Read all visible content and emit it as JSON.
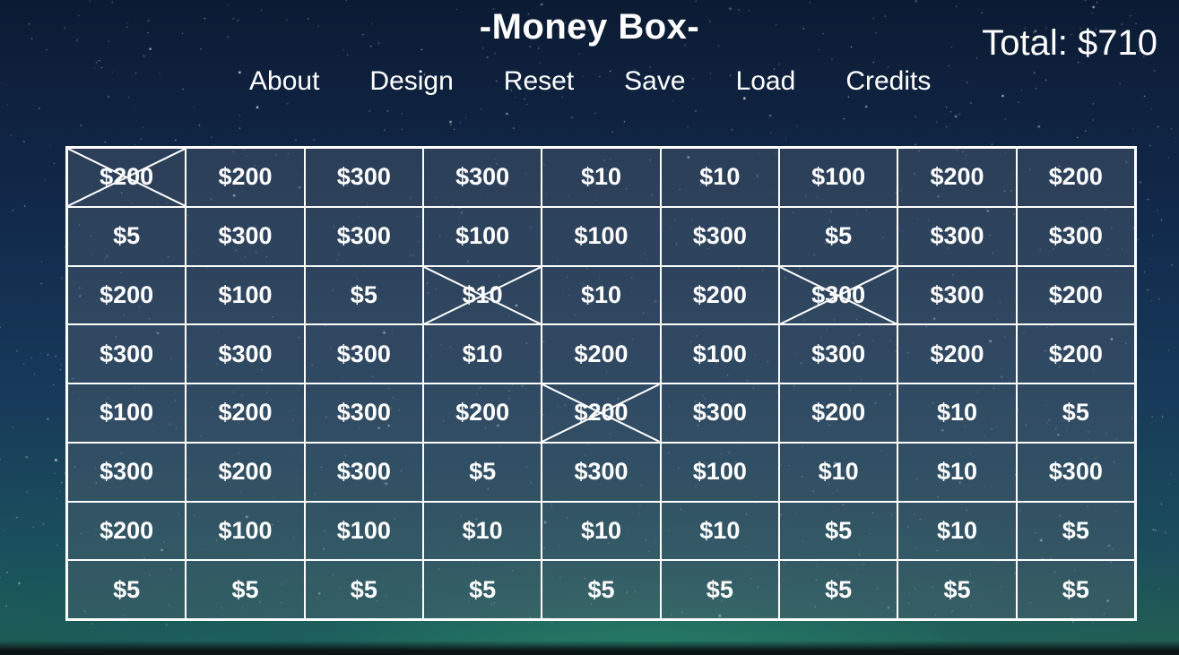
{
  "title": "-Money Box-",
  "total_label": "Total: $710",
  "nav": [
    {
      "label": "About"
    },
    {
      "label": "Design"
    },
    {
      "label": "Reset"
    },
    {
      "label": "Save"
    },
    {
      "label": "Load"
    },
    {
      "label": "Credits"
    }
  ],
  "grid": {
    "rows": [
      [
        "$200",
        "$200",
        "$300",
        "$300",
        "$10",
        "$10",
        "$100",
        "$200",
        "$200"
      ],
      [
        "$5",
        "$300",
        "$300",
        "$100",
        "$100",
        "$300",
        "$5",
        "$300",
        "$300"
      ],
      [
        "$200",
        "$100",
        "$5",
        "$10",
        "$10",
        "$200",
        "$300",
        "$300",
        "$200"
      ],
      [
        "$300",
        "$300",
        "$300",
        "$10",
        "$200",
        "$100",
        "$300",
        "$200",
        "$200"
      ],
      [
        "$100",
        "$200",
        "$300",
        "$200",
        "$200",
        "$300",
        "$200",
        "$10",
        "$5"
      ],
      [
        "$300",
        "$200",
        "$300",
        "$5",
        "$300",
        "$100",
        "$10",
        "$10",
        "$300"
      ],
      [
        "$200",
        "$100",
        "$100",
        "$10",
        "$10",
        "$10",
        "$5",
        "$10",
        "$5"
      ],
      [
        "$5",
        "$5",
        "$5",
        "$5",
        "$5",
        "$5",
        "$5",
        "$5",
        "$5"
      ]
    ],
    "crossed": [
      [
        0,
        0
      ],
      [
        2,
        3
      ],
      [
        2,
        6
      ],
      [
        4,
        4
      ]
    ]
  },
  "colors": {
    "grid_line": "#ffffff",
    "cell_fill": "rgba(80, 95, 110, 0.45)",
    "text": "#ffffff"
  }
}
